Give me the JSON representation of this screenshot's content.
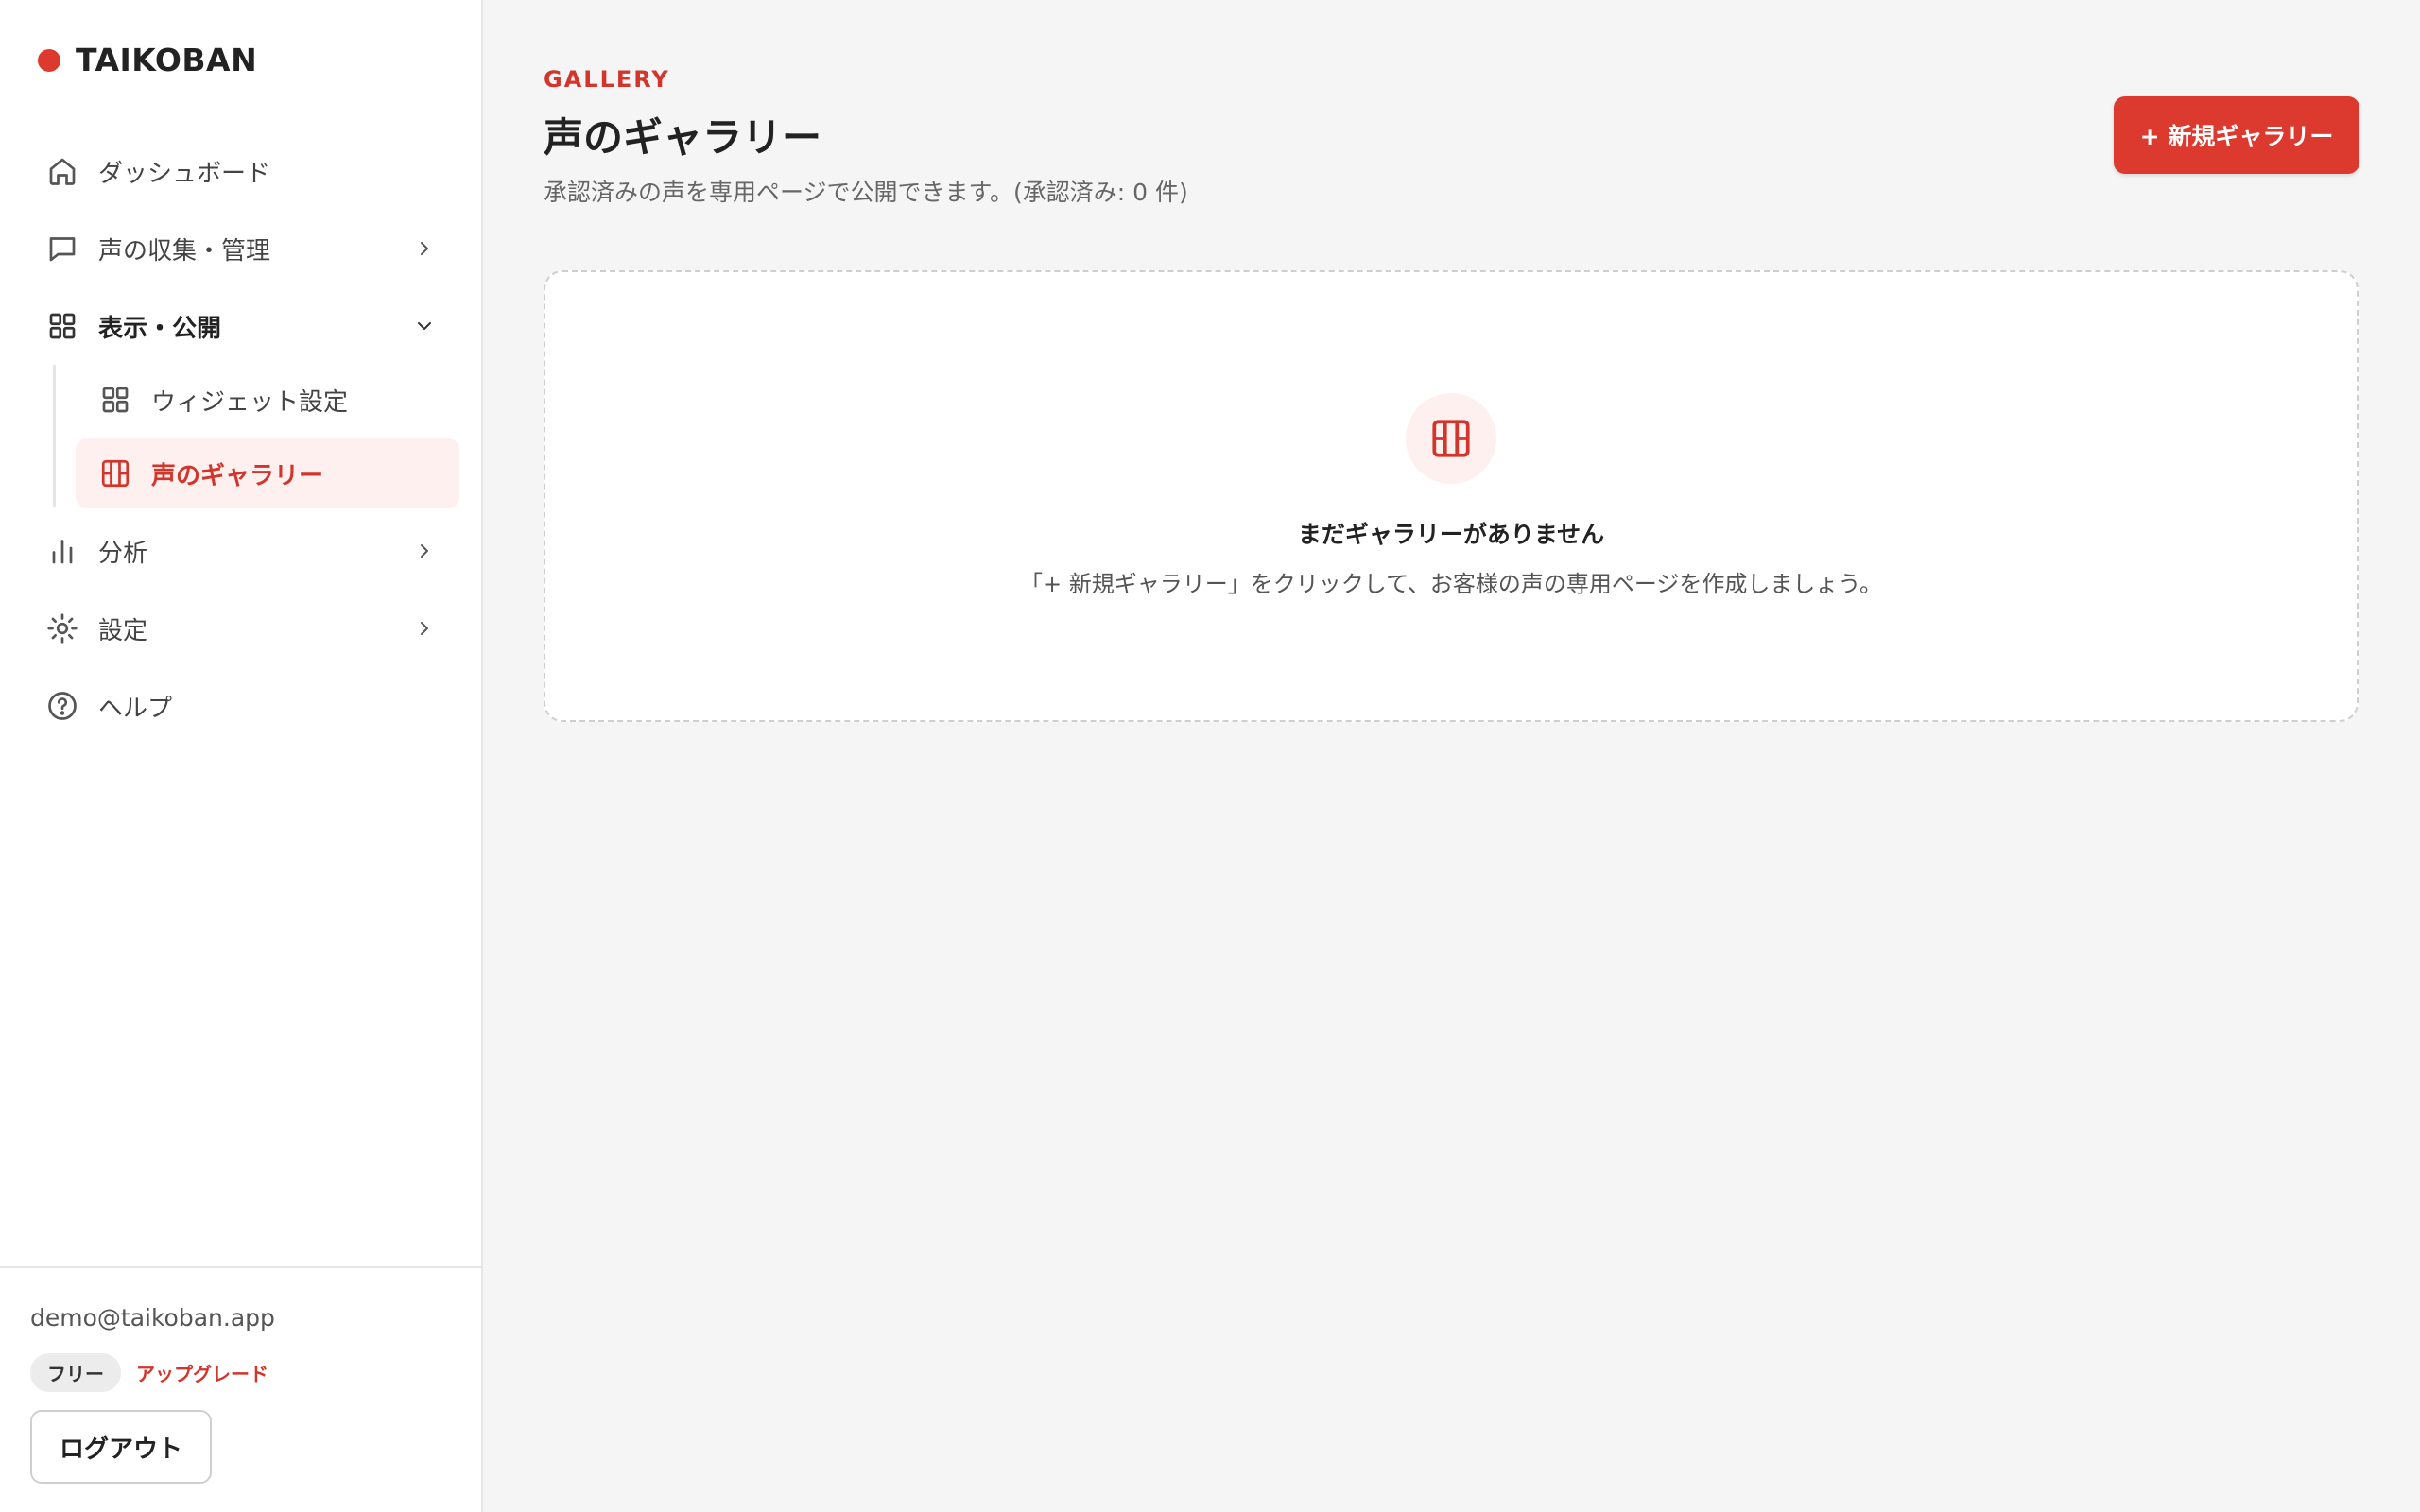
{
  "brand": {
    "name": "TAIKOBAN",
    "accent": "#dc3a2f"
  },
  "sidebar": {
    "items": [
      {
        "label": "ダッシュボード",
        "icon": "home-icon"
      },
      {
        "label": "声の収集・管理",
        "icon": "message-square-icon"
      },
      {
        "label": "表示・公開",
        "icon": "grid-icon",
        "expanded": true,
        "children": [
          {
            "label": "ウィジェット設定",
            "icon": "grid-icon"
          },
          {
            "label": "声のギャラリー",
            "icon": "gallery-icon",
            "active": true
          }
        ]
      },
      {
        "label": "分析",
        "icon": "bar-chart-icon"
      },
      {
        "label": "設定",
        "icon": "gear-icon"
      },
      {
        "label": "ヘルプ",
        "icon": "help-circle-icon"
      }
    ],
    "footer": {
      "email": "demo@taikoban.app",
      "plan": "フリー",
      "upgrade": "アップグレード",
      "logout": "ログアウト"
    }
  },
  "main": {
    "eyebrow": "GALLERY",
    "title": "声のギャラリー",
    "subtitle": "承認済みの声を専用ページで公開できます。(承認済み: 0 件)",
    "new_button": "+ 新規ギャラリー",
    "empty": {
      "icon": "gallery-icon",
      "title": "まだギャラリーがありません",
      "description": "「+ 新規ギャラリー」をクリックして、お客様の声の専用ページを作成しましょう。"
    }
  }
}
